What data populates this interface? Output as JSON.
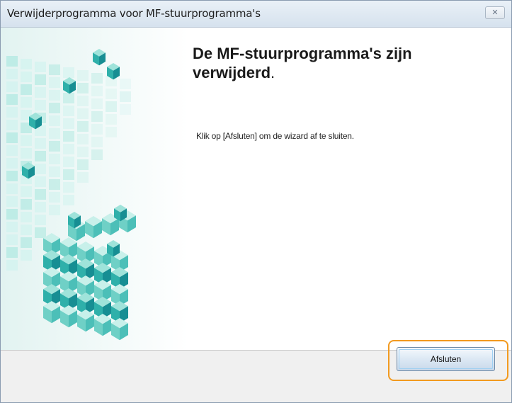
{
  "window": {
    "title": "Verwijderprogramma voor MF-stuurprogramma's"
  },
  "main": {
    "heading_line1": "De MF-stuurprogramma's zijn",
    "heading_line2": "verwijderd",
    "heading_period": ".",
    "instruction": "Klik op [Afsluten] om de wizard af te sluiten."
  },
  "footer": {
    "finish_label": "Afsluten"
  },
  "icons": {
    "close": "close-icon",
    "graphic": "cube-graphic"
  },
  "colors": {
    "focus_highlight": "#f29a1f",
    "graphic_teal": "#27b7b0"
  }
}
